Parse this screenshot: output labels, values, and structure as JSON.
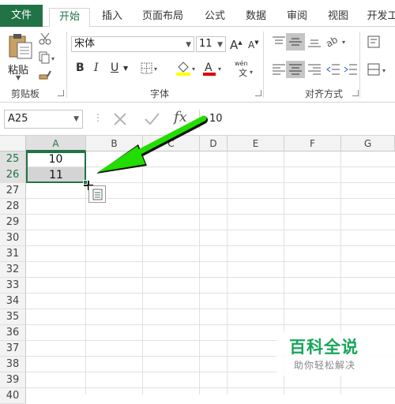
{
  "tabs": [
    "文件",
    "开始",
    "插入",
    "页面布局",
    "公式",
    "数据",
    "审阅",
    "视图",
    "开发工"
  ],
  "active_tab": "开始",
  "ribbon": {
    "clipboard": {
      "paste_label": "粘贴",
      "group_label": "剪贴板"
    },
    "font": {
      "font_name": "宋体",
      "font_size": "11",
      "group_label": "字体",
      "bold": "B",
      "italic": "I",
      "underline": "U"
    },
    "alignment": {
      "group_label": "对齐方式"
    }
  },
  "formula_bar": {
    "name_box": "A25",
    "fx_label": "fx",
    "value": "10"
  },
  "columns": [
    "A",
    "B",
    "C",
    "D",
    "E",
    "F",
    "G"
  ],
  "selected_column": "A",
  "rows": [
    "25",
    "26",
    "27",
    "28",
    "29",
    "30",
    "31",
    "32",
    "33",
    "34",
    "35",
    "36",
    "37",
    "38",
    "39",
    "40"
  ],
  "selected_rows": [
    "25",
    "26"
  ],
  "cells": {
    "A25": "10",
    "A26": "11"
  },
  "watermark": {
    "title": "百科全说",
    "subtitle": "助你轻松解决"
  },
  "colors": {
    "accent": "#217346",
    "arrow": "#22dd00"
  }
}
